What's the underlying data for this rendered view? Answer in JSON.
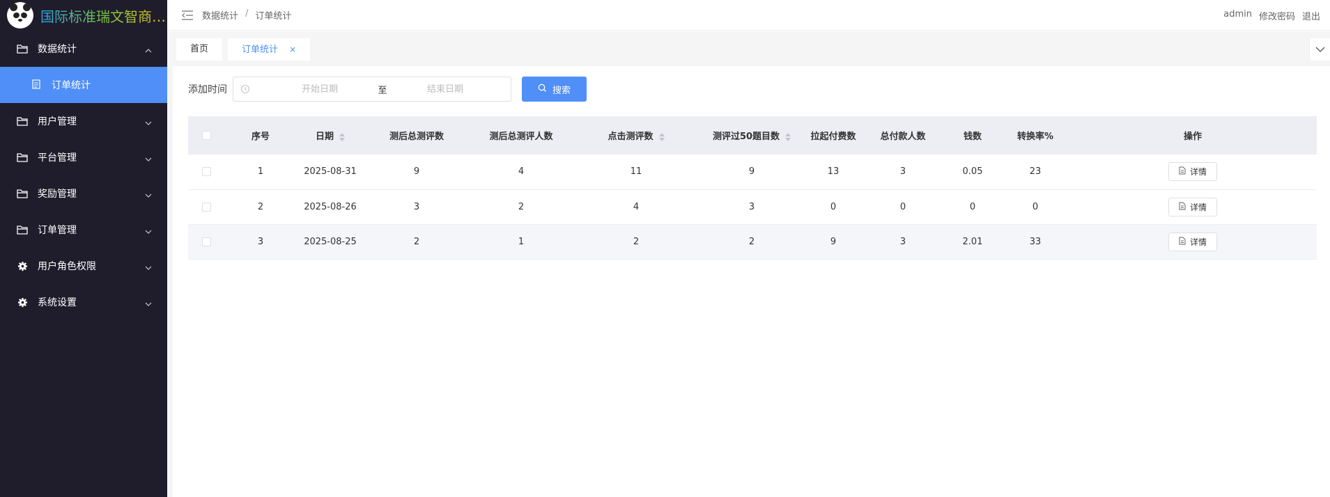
{
  "brand": {
    "title": "国际标准瑞文智商测评"
  },
  "sidebar": {
    "items": [
      {
        "label": "数据统计",
        "icon": "folder-icon",
        "expanded": true,
        "children": [
          {
            "label": "订单统计",
            "icon": "document-icon"
          }
        ]
      },
      {
        "label": "用户管理",
        "icon": "folder-icon",
        "expanded": false
      },
      {
        "label": "平台管理",
        "icon": "folder-icon",
        "expanded": false
      },
      {
        "label": "奖励管理",
        "icon": "folder-icon",
        "expanded": false
      },
      {
        "label": "订单管理",
        "icon": "folder-icon",
        "expanded": false
      },
      {
        "label": "用户角色权限",
        "icon": "gear-icon",
        "expanded": false
      },
      {
        "label": "系统设置",
        "icon": "gear-icon",
        "expanded": false
      }
    ]
  },
  "header": {
    "breadcrumb": [
      "数据统计",
      "订单统计"
    ],
    "separator": "/",
    "user": "admin",
    "change_password": "修改密码",
    "logout": "退出"
  },
  "tags": [
    {
      "label": "首页",
      "active": false
    },
    {
      "label": "订单统计",
      "active": true,
      "close": "×"
    }
  ],
  "filter": {
    "label": "添加时间",
    "start_placeholder": "开始日期",
    "to": "至",
    "end_placeholder": "结束日期",
    "search_label": "搜索"
  },
  "table": {
    "columns": [
      "序号",
      "日期",
      "测后总测评数",
      "测后总测评人数",
      "点击测评数",
      "测评过50题目数",
      "拉起付费数",
      "总付款人数",
      "钱数",
      "转换率%",
      "操作"
    ],
    "sortable": [
      "日期",
      "点击测评数",
      "测评过50题目数"
    ],
    "detail_label": "详情",
    "rows": [
      [
        "1",
        "2025-08-31",
        "9",
        "4",
        "11",
        "9",
        "13",
        "3",
        "0.05",
        "23"
      ],
      [
        "2",
        "2025-08-26",
        "3",
        "2",
        "4",
        "3",
        "0",
        "0",
        "0",
        "0"
      ],
      [
        "3",
        "2025-08-25",
        "2",
        "1",
        "2",
        "2",
        "9",
        "3",
        "2.01",
        "33"
      ]
    ]
  },
  "colors": {
    "accent": "#4f8ff7",
    "sidebar_bg": "#1f1d2b",
    "header_row_bg": "#eceef4"
  }
}
